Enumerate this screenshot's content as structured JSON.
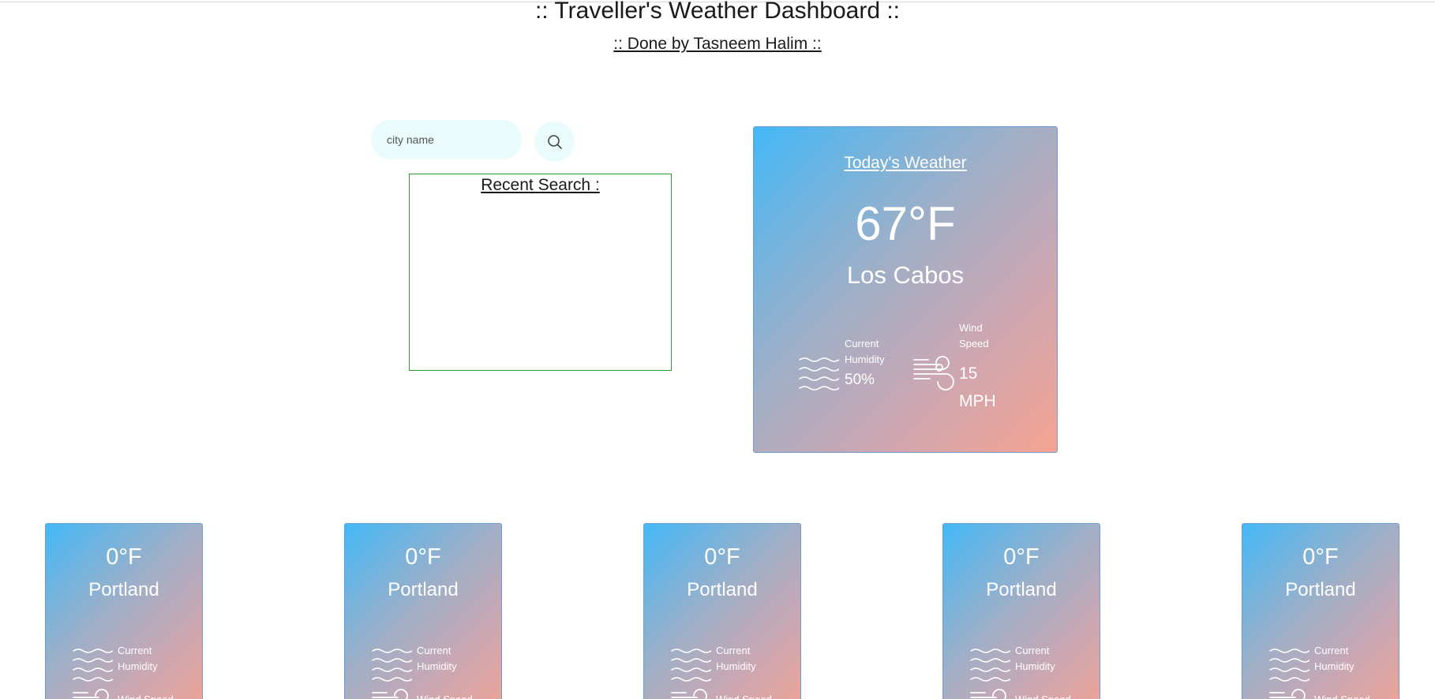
{
  "header": {
    "title": ":: Traveller's Weather Dashboard ::",
    "subtitle": ":: Done by Tasneem Halim ::"
  },
  "search": {
    "placeholder": "city name",
    "button_icon": "search-icon"
  },
  "recent": {
    "title": "Recent Search :",
    "items": []
  },
  "today": {
    "heading": "Today's Weather",
    "temperature": "67°F",
    "city": "Los Cabos",
    "humidity_label": "Current Humidity",
    "humidity_value": "50%",
    "humidity_icon": "waves-icon",
    "wind_label": "Wind Speed",
    "wind_value": "15 MPH",
    "wind_icon": "wind-icon"
  },
  "forecast": [
    {
      "temperature": "0°F",
      "city": "Portland",
      "humidity_label": "Current Humidity",
      "wind_label": "Wind Speed"
    },
    {
      "temperature": "0°F",
      "city": "Portland",
      "humidity_label": "Current Humidity",
      "wind_label": "Wind Speed"
    },
    {
      "temperature": "0°F",
      "city": "Portland",
      "humidity_label": "Current Humidity",
      "wind_label": "Wind Speed"
    },
    {
      "temperature": "0°F",
      "city": "Portland",
      "humidity_label": "Current Humidity",
      "wind_label": "Wind Speed"
    },
    {
      "temperature": "0°F",
      "city": "Portland",
      "humidity_label": "Current Humidity",
      "wind_label": "Wind Speed"
    }
  ],
  "colors": {
    "card_gradient_start": "#44b8f7",
    "card_gradient_end": "#f6a391",
    "input_background": "#e9fcfb",
    "recent_border": "#2e9a2e"
  }
}
